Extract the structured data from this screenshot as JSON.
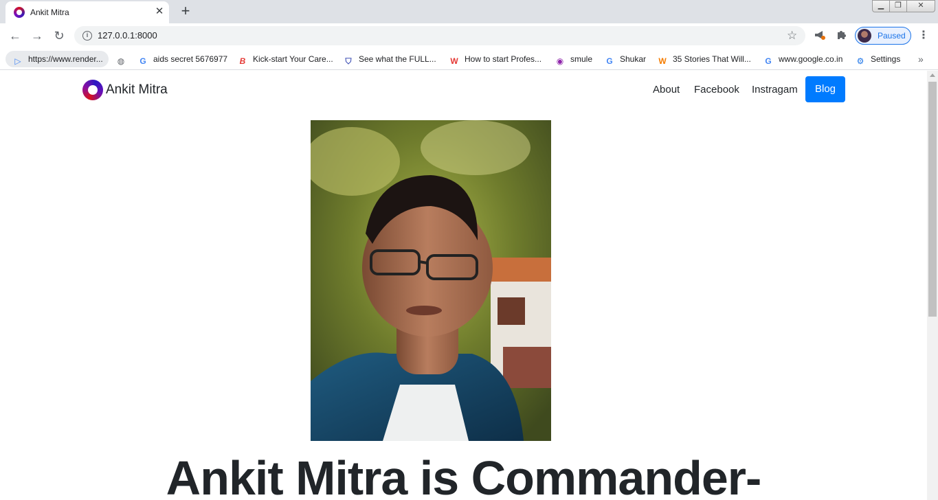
{
  "browser": {
    "tab": {
      "title": "Ankit Mitra",
      "close_glyph": "✕"
    },
    "new_tab_glyph": "+",
    "window_controls": {
      "minimize": "▁",
      "maximize": "❐",
      "close": "✕"
    },
    "toolbar": {
      "back_glyph": "←",
      "forward_glyph": "→",
      "reload_glyph": "↻",
      "url": "127.0.0.1:8000",
      "profile_status": "Paused"
    },
    "bookmarks": [
      {
        "label": "https://www.render...",
        "icon": "render-icon",
        "color": "#4285f4"
      },
      {
        "label": "",
        "icon": "globe-icon",
        "color": "#5f6368"
      },
      {
        "label": "aids secret 5676977",
        "icon": "google-icon",
        "color": "#4285f4"
      },
      {
        "label": "Kick-start Your Care...",
        "icon": "b-logo-icon",
        "color": "#e53935"
      },
      {
        "label": "See what the FULL...",
        "icon": "shield-icon",
        "color": "#3f51b5"
      },
      {
        "label": "How to start Profes...",
        "icon": "w-logo-icon",
        "color": "#e53935"
      },
      {
        "label": "smule",
        "icon": "smule-icon",
        "color": "#8e24aa"
      },
      {
        "label": "Shukar",
        "icon": "google-icon",
        "color": "#4285f4"
      },
      {
        "label": "35 Stories That Will...",
        "icon": "wattpad-icon",
        "color": "#f57c00"
      },
      {
        "label": "www.google.co.in",
        "icon": "google-icon",
        "color": "#4285f4"
      },
      {
        "label": "Settings",
        "icon": "gear-icon",
        "color": "#1a73e8"
      }
    ],
    "bookmarks_more": "»"
  },
  "site": {
    "brand_name": "Ankit Mitra",
    "nav": {
      "about": "About",
      "facebook": "Facebook",
      "instagram": "Instragam",
      "blog": "Blog"
    },
    "headline": "Ankit Mitra is Commander-",
    "accent_color": "#007bff"
  }
}
